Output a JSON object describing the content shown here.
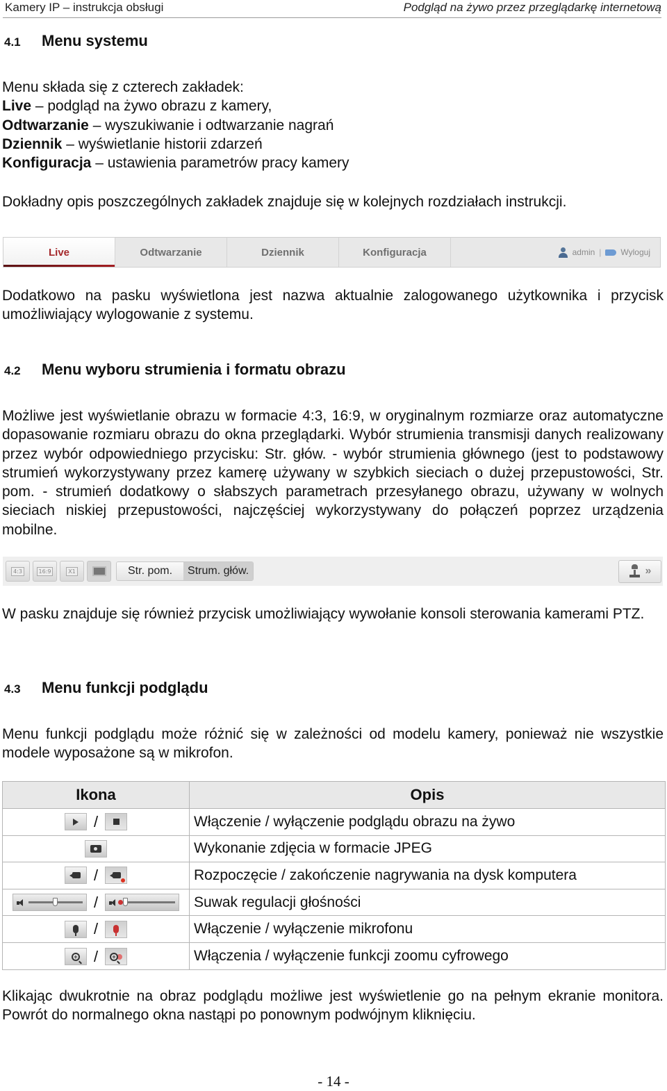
{
  "running_header": {
    "left": "Kamery IP – instrukcja obsługi",
    "right": "Podgląd na żywo przez przeglądarkę internetową"
  },
  "section_4_1": {
    "number": "4.1",
    "title": "Menu systemu",
    "intro": "Menu składa się z czterech zakładek:",
    "items": [
      {
        "term": "Live",
        "desc": " – podgląd na żywo obrazu z kamery,"
      },
      {
        "term": "Odtwarzanie",
        "desc": " – wyszukiwanie i odtwarzanie nagrań"
      },
      {
        "term": "Dziennik",
        "desc": " – wyświetlanie historii zdarzeń"
      },
      {
        "term": "Konfiguracja",
        "desc": " – ustawienia parametrów pracy kamery"
      }
    ],
    "details_note": "Dokładny opis poszczególnych zakładek znajduje się w kolejnych rozdziałach instrukcji.",
    "tabbar": {
      "tabs": [
        {
          "label": "Live",
          "active": true
        },
        {
          "label": "Odtwarzanie",
          "active": false
        },
        {
          "label": "Dziennik",
          "active": false
        },
        {
          "label": "Konfiguracja",
          "active": false
        }
      ],
      "user_icon": "user-icon",
      "username": "admin",
      "separator": "|",
      "logout_icon": "logout-icon",
      "logout_label": "Wyloguj",
      "active_color": "#a4272a"
    },
    "after_bar": "Dodatkowo na pasku wyświetlona jest nazwa aktualnie zalogowanego użytkownika i przycisk umożliwiający wylogowanie z systemu."
  },
  "section_4_2": {
    "number": "4.2",
    "title": "Menu wyboru strumienia i formatu obrazu",
    "body": "Możliwe jest wyświetlanie obrazu w formacie 4:3, 16:9, w oryginalnym rozmiarze oraz automatyczne dopasowanie rozmiaru obrazu do okna przeglądarki. Wybór strumienia transmisji danych realizowany przez wybór odpowiedniego przycisku: Str. głów. - wybór strumienia głównego (jest to podstawowy strumień wykorzystywany przez kamerę używany w szybkich sieciach o dużej przepustowości, Str. pom. - strumień dodatkowy o słabszych parametrach przesyłanego obrazu, używany w wolnych sieciach niskiej przepustowości, najczęściej wykorzystywany do połączeń poprzez urządzenia mobilne.",
    "toolbar": {
      "format_buttons": [
        "4:3",
        "16:9",
        "X1"
      ],
      "fit_icon": "fit-window-icon",
      "stream_buttons": [
        {
          "label": "Str. pom.",
          "active": false
        },
        {
          "label": "Strum. głów.",
          "active": true
        }
      ],
      "ptz_icon": "joystick-icon",
      "ptz_arrows": "»"
    },
    "after_bar": "W pasku znajduje się również przycisk umożliwiający wywołanie konsoli sterowania kamerami PTZ."
  },
  "section_4_3": {
    "number": "4.3",
    "title": "Menu funkcji podglądu",
    "body": "Menu funkcji podglądu może różnić się w zależności od modelu kamery, ponieważ nie wszystkie modele wyposażone są w mikrofon.",
    "table": {
      "headers": [
        "Ikona",
        "Opis"
      ],
      "separator": "/",
      "rows": [
        {
          "icons": [
            "play-icon",
            "stop-icon"
          ],
          "desc": "Włączenie / wyłączenie podglądu obrazu na żywo"
        },
        {
          "icons": [
            "snapshot-camera-icon"
          ],
          "desc": "Wykonanie zdjęcia w formacie JPEG"
        },
        {
          "icons": [
            "record-start-icon",
            "record-stop-icon"
          ],
          "desc": "Rozpoczęcie / zakończenie nagrywania na dysk komputera"
        },
        {
          "icons": [
            "volume-slider-icon",
            "volume-muted-slider-icon"
          ],
          "desc": "Suwak regulacji głośności",
          "volume_level": 0.5,
          "muted_level": 0.0
        },
        {
          "icons": [
            "microphone-on-icon",
            "microphone-off-icon"
          ],
          "desc": "Włączenie / wyłączenie mikrofonu"
        },
        {
          "icons": [
            "digital-zoom-on-icon",
            "digital-zoom-off-icon"
          ],
          "desc": "Włączenia / wyłączenie funkcji zoomu cyfrowego"
        }
      ]
    },
    "footer_note": "Klikając dwukrotnie na obraz podglądu możliwe jest wyświetlenie go na pełnym ekranie monitora. Powrót do normalnego okna nastąpi po ponownym podwójnym kliknięciu."
  },
  "page_number": "- 14 -"
}
